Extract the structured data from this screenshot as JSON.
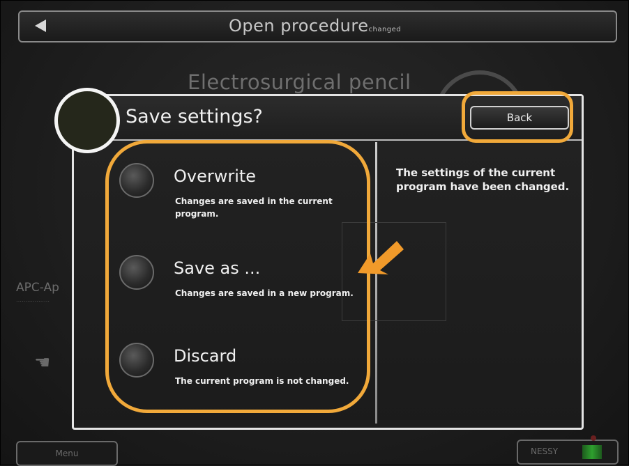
{
  "topbar": {
    "title": "Open procedure",
    "title_suffix": "changed"
  },
  "background": {
    "title": "Electrosurgical pencil",
    "side_label": "APC-Ap",
    "side_sub": "………………"
  },
  "dialog": {
    "title": "Save settings?",
    "back_label": "Back",
    "options": [
      {
        "label": "Overwrite",
        "desc": "Changes are saved in the current program."
      },
      {
        "label": "Save as ...",
        "desc": "Changes are saved in a new program."
      },
      {
        "label": "Discard",
        "desc": "The current program is not changed."
      }
    ],
    "info": "The settings of the current program have been changed."
  },
  "bottombar": {
    "menu_label": "Menu",
    "nessy_label": "NESSY"
  },
  "colors": {
    "highlight": "#f1a93a",
    "nessy_green": "#2ea02e"
  },
  "icons": {
    "back": "back-arrow-icon",
    "pointer": "orange-arrow-icon"
  }
}
